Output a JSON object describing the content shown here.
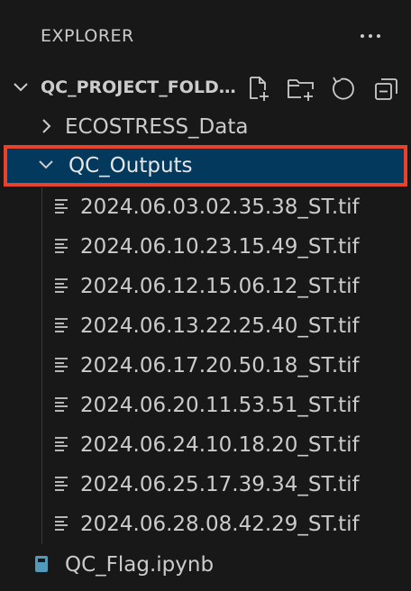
{
  "explorer": {
    "title": "EXPLORER",
    "more_icon": "ellipsis-icon"
  },
  "project": {
    "name": "QC_PROJECT_FOLDER",
    "toolbar": [
      {
        "icon": "new-file-icon"
      },
      {
        "icon": "new-folder-icon"
      },
      {
        "icon": "refresh-icon"
      },
      {
        "icon": "collapse-all-icon"
      }
    ]
  },
  "tree": {
    "folders": [
      {
        "label": "ECOSTRESS_Data",
        "expanded": false
      },
      {
        "label": "QC_Outputs",
        "expanded": true,
        "selected": true
      }
    ],
    "files": [
      {
        "label": "2024.06.03.02.35.38_ST.tif"
      },
      {
        "label": "2024.06.10.23.15.49_ST.tif"
      },
      {
        "label": "2024.06.12.15.06.12_ST.tif"
      },
      {
        "label": "2024.06.13.22.25.40_ST.tif"
      },
      {
        "label": "2024.06.17.20.50.18_ST.tif"
      },
      {
        "label": "2024.06.20.11.53.51_ST.tif"
      },
      {
        "label": "2024.06.24.10.18.20_ST.tif"
      },
      {
        "label": "2024.06.25.17.39.34_ST.tif"
      },
      {
        "label": "2024.06.28.08.42.29_ST.tif"
      }
    ],
    "notebook": {
      "label": "QC_Flag.ipynb",
      "icon": "notebook-icon"
    }
  },
  "colors": {
    "background": "#181818",
    "text": "#cccccc",
    "selection_background": "#04395e",
    "highlight_border": "#e8412c",
    "notebook_icon": "#519aba"
  }
}
